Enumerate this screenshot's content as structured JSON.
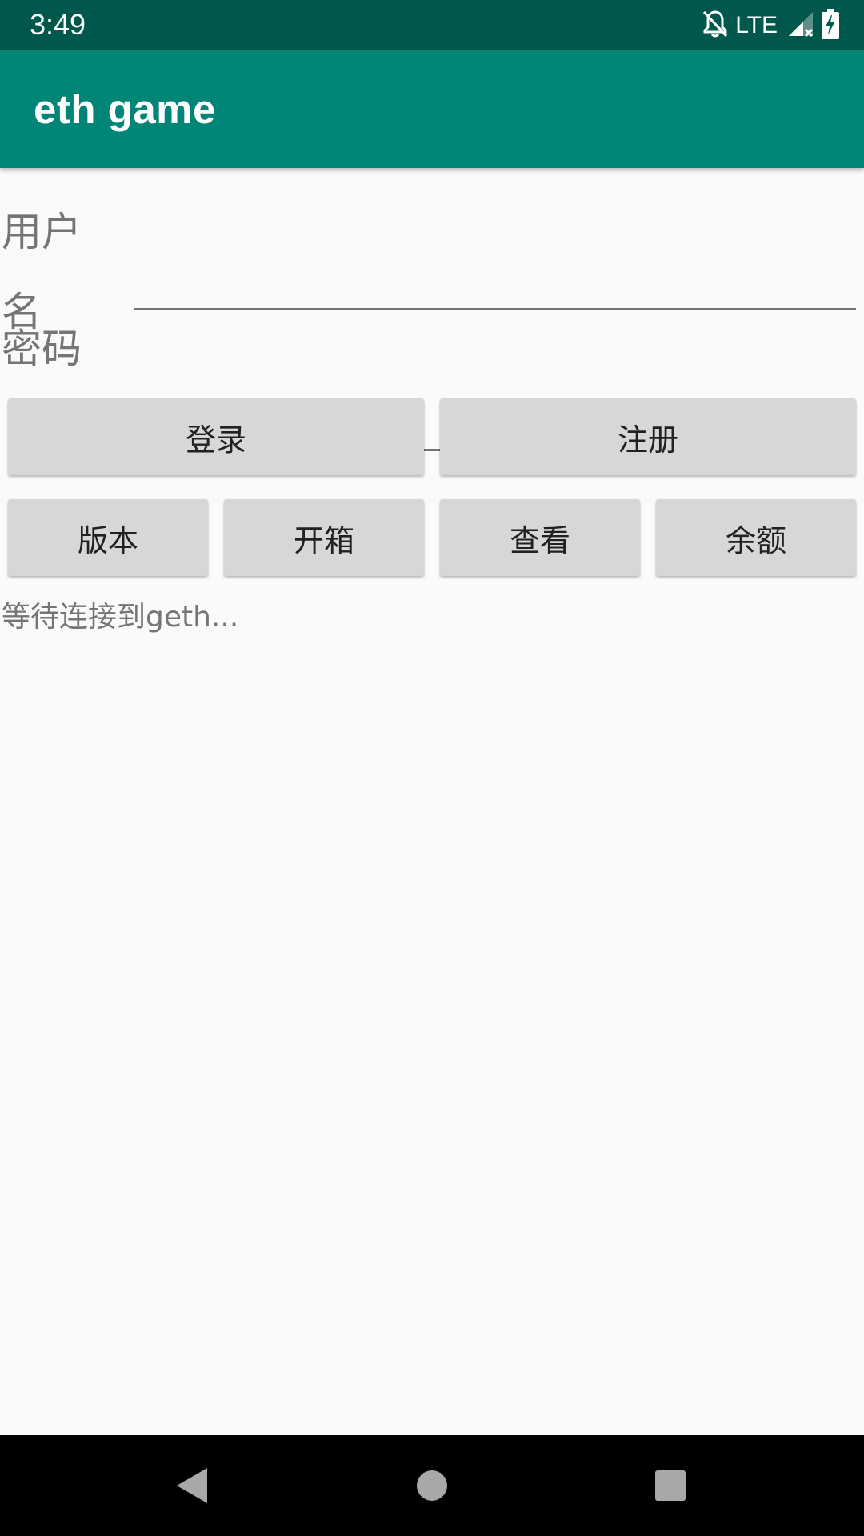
{
  "status_bar": {
    "time": "3:49",
    "network_label": "LTE",
    "icons": [
      "notifications-off-icon",
      "signal-icon",
      "battery-charging-icon"
    ]
  },
  "app_bar": {
    "title": "eth game",
    "color": "#008577"
  },
  "form": {
    "username_label": "用户名",
    "username_value": "",
    "password_label": "密码",
    "password_value": ""
  },
  "buttons_row1": {
    "login": "登录",
    "register": "注册"
  },
  "buttons_row2": {
    "version": "版本",
    "open_box": "开箱",
    "view": "查看",
    "balance": "余额"
  },
  "status_message": "等待连接到geth...",
  "nav_bar": {
    "icons": [
      "back-icon",
      "home-icon",
      "recents-icon"
    ]
  },
  "colors": {
    "status_bar": "#00574b",
    "app_bar": "#008577",
    "button": "#d6d7d7",
    "background": "#fafafa"
  }
}
